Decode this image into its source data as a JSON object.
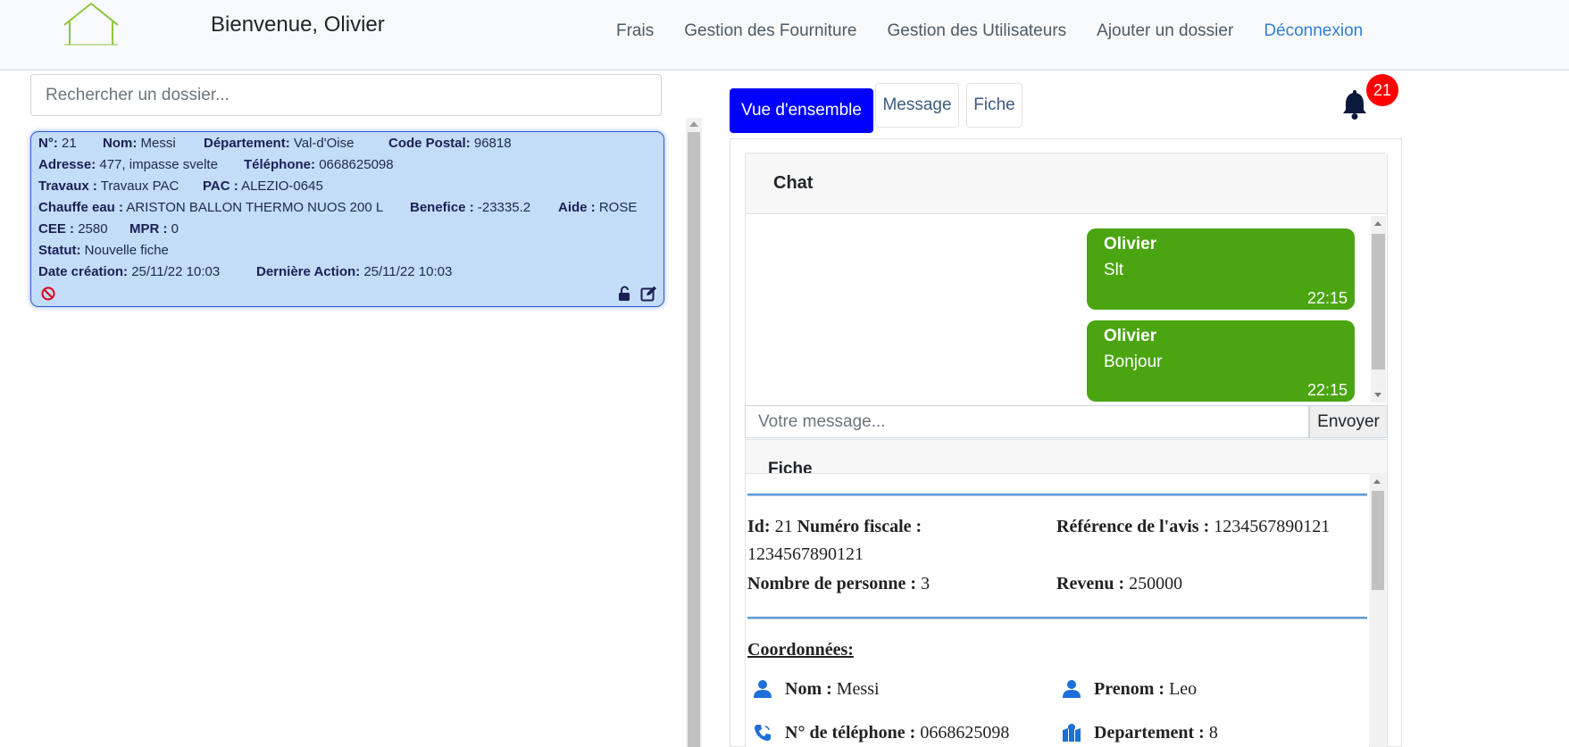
{
  "header": {
    "welcome": "Bienvenue, Olivier",
    "nav": [
      "Frais",
      "Gestion des Fourniture",
      "Gestion des Utilisateurs",
      "Ajouter un dossier"
    ],
    "logout": "Déconnexion"
  },
  "search": {
    "placeholder": "Rechercher un dossier..."
  },
  "dossier": {
    "num_label": "N°:",
    "num": "21",
    "nom_label": "Nom:",
    "nom": "Messi",
    "dep_label": "Département:",
    "dep": "Val-d'Oise",
    "cp_label": "Code Postal:",
    "cp": "96818",
    "adresse_label": "Adresse:",
    "adresse": "477, impasse svelte",
    "tel_label": "Téléphone:",
    "tel": "0668625098",
    "travaux_label": "Travaux :",
    "travaux": "Travaux PAC",
    "pac_label": "PAC :",
    "pac": "ALEZIO-0645",
    "chauffe_label": "Chauffe eau :",
    "chauffe": "ARISTON BALLON THERMO NUOS 200 L",
    "benefice_label": "Benefice :",
    "benefice": "-23335.2",
    "aide_label": "Aide :",
    "aide": "ROSE",
    "cee_label": "CEE :",
    "cee": "2580",
    "mpr_label": "MPR :",
    "mpr": "0",
    "statut_label": "Statut:",
    "statut": "Nouvelle fiche",
    "creation_label": "Date création:",
    "creation": "25/11/22 10:03",
    "action_label": "Dernière Action:",
    "action": "25/11/22 10:03"
  },
  "tabs": {
    "overview": "Vue d'ensemble",
    "message": "Message",
    "fiche": "Fiche"
  },
  "notifications": {
    "count": "21"
  },
  "chat": {
    "title": "Chat",
    "messages": [
      {
        "author": "Olivier",
        "text": "Slt",
        "time": "22:15"
      },
      {
        "author": "Olivier",
        "text": "Bonjour",
        "time": "22:15"
      }
    ],
    "input_placeholder": "Votre message...",
    "send": "Envoyer"
  },
  "fiche": {
    "title": "Fiche",
    "id_label": "Id:",
    "id": "21",
    "fiscal_label": "Numéro fiscale :",
    "fiscal": "1234567890121",
    "ref_label": "Référence de l'avis :",
    "ref": "1234567890121",
    "personnes_label": "Nombre de personne :",
    "personnes": "3",
    "revenu_label": "Revenu :",
    "revenu": "250000",
    "coord_title": "Coordonnées:",
    "nom_label": "Nom :",
    "nom": "Messi",
    "prenom_label": "Prenom :",
    "prenom": "Leo",
    "tel_label": "N° de téléphone :",
    "tel": "0668625098",
    "dep_label": "Departement :",
    "dep": "8"
  },
  "colors": {
    "accent": "#0000ff",
    "chat_bubble": "#4aa511",
    "card_bg": "#c3dcf7",
    "badge": "#ff0000"
  }
}
